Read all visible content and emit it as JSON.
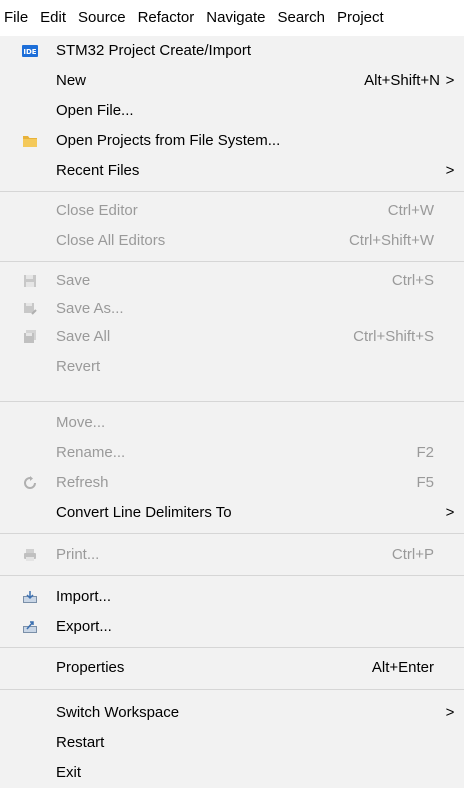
{
  "menubar": {
    "items": [
      "File",
      "Edit",
      "Source",
      "Refactor",
      "Navigate",
      "Search",
      "Project"
    ]
  },
  "menu": {
    "stm32": {
      "label": "STM32 Project Create/Import",
      "icon": "ide-icon"
    },
    "new": {
      "label": "New",
      "accel": "Alt+Shift+N",
      "arrow": ">"
    },
    "open_file": {
      "label": "Open File..."
    },
    "open_projects": {
      "label": "Open Projects from File System...",
      "icon": "folder-icon"
    },
    "recent_files": {
      "label": "Recent Files",
      "arrow": ">"
    },
    "close_editor": {
      "label": "Close Editor",
      "accel": "Ctrl+W"
    },
    "close_all": {
      "label": "Close All Editors",
      "accel": "Ctrl+Shift+W"
    },
    "save": {
      "label": "Save",
      "accel": "Ctrl+S",
      "icon": "save-icon"
    },
    "save_as": {
      "label": "Save As...",
      "icon": "save-as-icon"
    },
    "save_all": {
      "label": "Save All",
      "accel": "Ctrl+Shift+S",
      "icon": "save-all-icon"
    },
    "revert": {
      "label": "Revert"
    },
    "move": {
      "label": "Move..."
    },
    "rename": {
      "label": "Rename...",
      "accel": "F2"
    },
    "refresh": {
      "label": "Refresh",
      "accel": "F5",
      "icon": "refresh-icon"
    },
    "convert": {
      "label": "Convert Line Delimiters To",
      "arrow": ">"
    },
    "print": {
      "label": "Print...",
      "accel": "Ctrl+P",
      "icon": "print-icon"
    },
    "import": {
      "label": "Import...",
      "icon": "import-icon"
    },
    "export": {
      "label": "Export...",
      "icon": "export-icon"
    },
    "properties": {
      "label": "Properties",
      "accel": "Alt+Enter"
    },
    "switch_workspace": {
      "label": "Switch Workspace",
      "arrow": ">"
    },
    "restart": {
      "label": "Restart"
    },
    "exit": {
      "label": "Exit"
    }
  },
  "colors": {
    "menu_bg": "#f2f2f2",
    "disabled_text": "#9a9a9a",
    "ide_badge": "#1e6fd9",
    "folder": "#e8b23a"
  }
}
